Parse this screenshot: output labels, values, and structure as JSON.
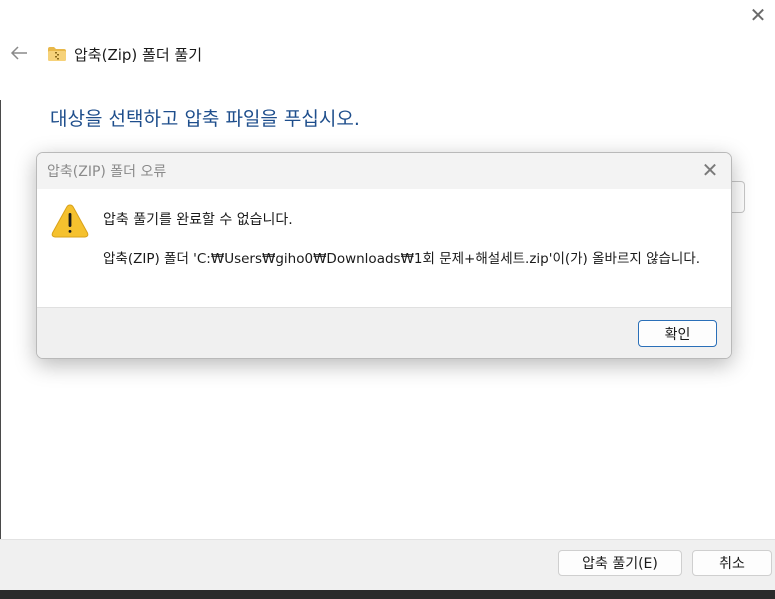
{
  "window": {
    "title": "압축(Zip) 폴더 풀기",
    "close_glyph": "✕",
    "instruction": "대상을 선택하고 압축 파일을 푸십시오."
  },
  "footer": {
    "extract_label": "압축 풀기(E)",
    "cancel_label": "취소"
  },
  "dialog": {
    "title": "압축(ZIP) 폴더 오류",
    "close_glyph": "✕",
    "heading": "압축 풀기를 완료할 수 없습니다.",
    "message": "압축(ZIP) 폴더 'C:₩Users₩giho0₩Downloads₩1회 문제+해설세트.zip'이(가) 올바르지 않습니다.",
    "ok_label": "확인"
  },
  "icons": {
    "back": "back-arrow-icon",
    "folder": "zip-folder-icon",
    "warning": "warning-icon",
    "close": "close-icon"
  },
  "colors": {
    "instruction_text": "#1e4e8c",
    "warning_fill": "#f5c12e",
    "ok_border": "#2a6fb8"
  }
}
